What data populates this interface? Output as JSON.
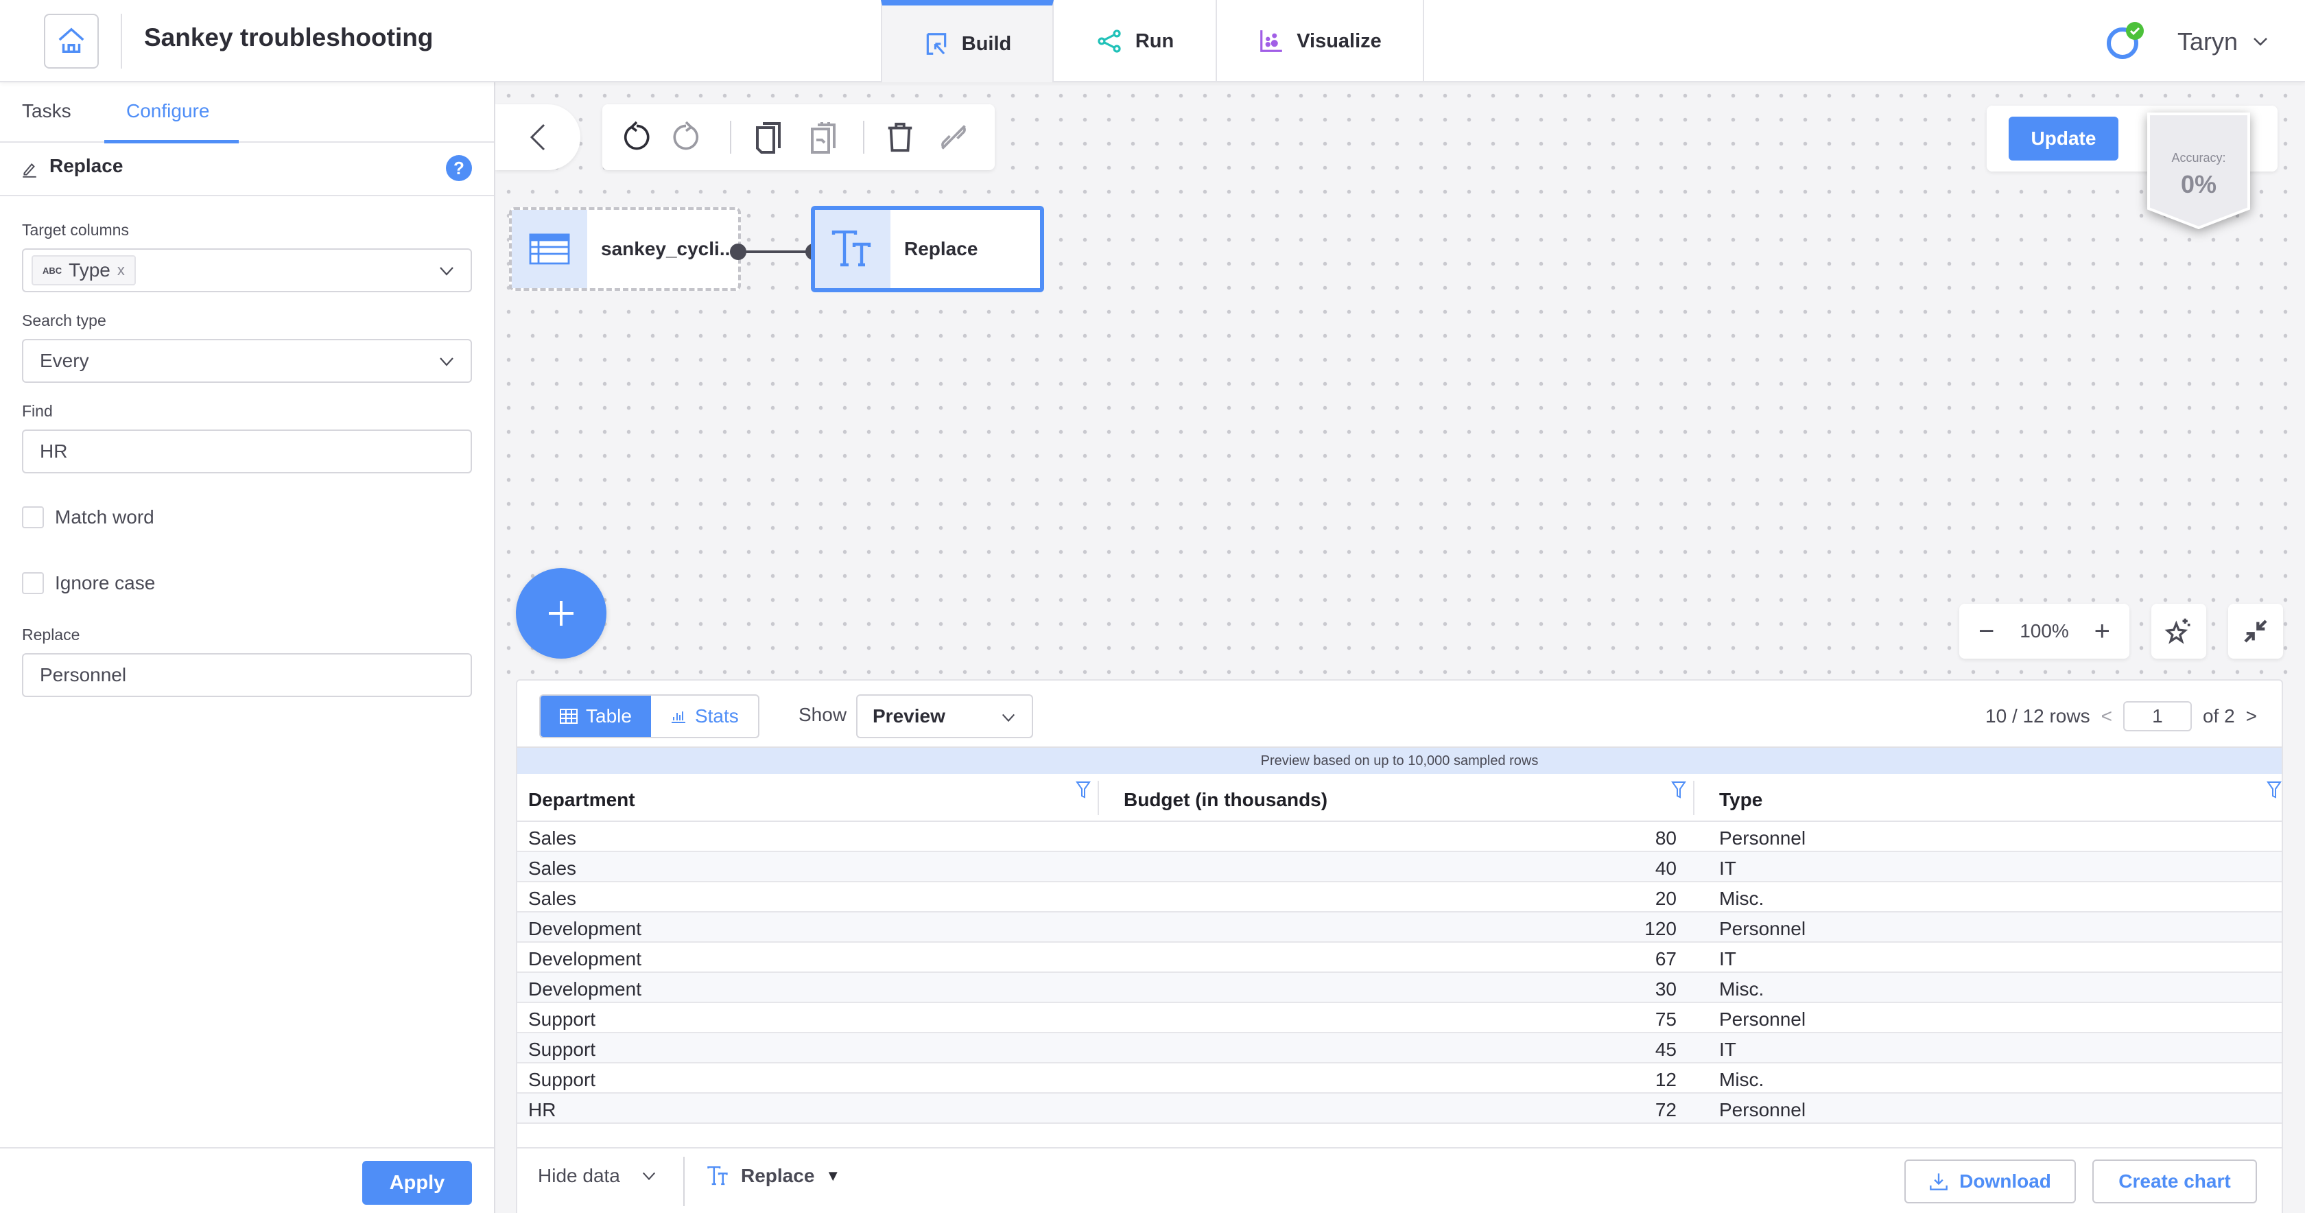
{
  "header": {
    "title": "Sankey troubleshooting",
    "modes": [
      {
        "label": "Build",
        "icon": "build-cursor-icon",
        "active": true
      },
      {
        "label": "Run",
        "icon": "share-nodes-icon",
        "active": false
      },
      {
        "label": "Visualize",
        "icon": "scatter-chart-icon",
        "active": false
      }
    ],
    "user": {
      "name": "Taryn",
      "status": "connected"
    }
  },
  "left_panel": {
    "tabs": [
      {
        "label": "Tasks",
        "active": false
      },
      {
        "label": "Configure",
        "active": true
      }
    ],
    "section_title": "Replace",
    "help_label": "?",
    "fields": {
      "target_columns": {
        "label": "Target columns",
        "chips": [
          {
            "type_badge": "ABC",
            "label": "Type",
            "remove": "x"
          }
        ]
      },
      "search_type": {
        "label": "Search type",
        "value": "Every"
      },
      "find": {
        "label": "Find",
        "value": "HR"
      },
      "match_word": {
        "label": "Match word",
        "checked": false
      },
      "ignore_case": {
        "label": "Ignore case",
        "checked": false
      },
      "replace": {
        "label": "Replace",
        "value": "Personnel"
      }
    },
    "apply_label": "Apply"
  },
  "canvas": {
    "nodes": [
      {
        "label": "sankey_cycli...",
        "icon": "table-icon",
        "selected": false
      },
      {
        "label": "Replace",
        "icon": "text-format-icon",
        "selected": true
      }
    ],
    "update_label": "Update",
    "accuracy": {
      "label": "Accuracy:",
      "value": "0%"
    },
    "zoom": {
      "value": "100%",
      "minus": "−",
      "plus": "+"
    }
  },
  "data_panel": {
    "view_tabs": [
      {
        "label": "Table",
        "active": true
      },
      {
        "label": "Stats",
        "active": false
      }
    ],
    "show_label": "Show",
    "show_value": "Preview",
    "rows_info": "10 / 12 rows",
    "page": {
      "current": "1",
      "of_label": "of 2",
      "prev": "<",
      "next": ">"
    },
    "notice": "Preview based on up to 10,000 sampled rows",
    "columns": [
      "Department",
      "Budget (in thousands)",
      "Type"
    ],
    "rows": [
      [
        "Sales",
        "80",
        "Personnel"
      ],
      [
        "Sales",
        "40",
        "IT"
      ],
      [
        "Sales",
        "20",
        "Misc."
      ],
      [
        "Development",
        "120",
        "Personnel"
      ],
      [
        "Development",
        "67",
        "IT"
      ],
      [
        "Development",
        "30",
        "Misc."
      ],
      [
        "Support",
        "75",
        "Personnel"
      ],
      [
        "Support",
        "45",
        "IT"
      ],
      [
        "Support",
        "12",
        "Misc."
      ],
      [
        "HR",
        "72",
        "Personnel"
      ]
    ],
    "footer": {
      "hide_data_label": "Hide data",
      "step_label": "Replace",
      "step_caret": "▼",
      "download_label": "Download",
      "create_chart_label": "Create chart"
    }
  },
  "colors": {
    "accent": "#4f8ef7",
    "run": "#20c1b8",
    "visualize": "#a15ee6",
    "success": "#4cc13a"
  }
}
